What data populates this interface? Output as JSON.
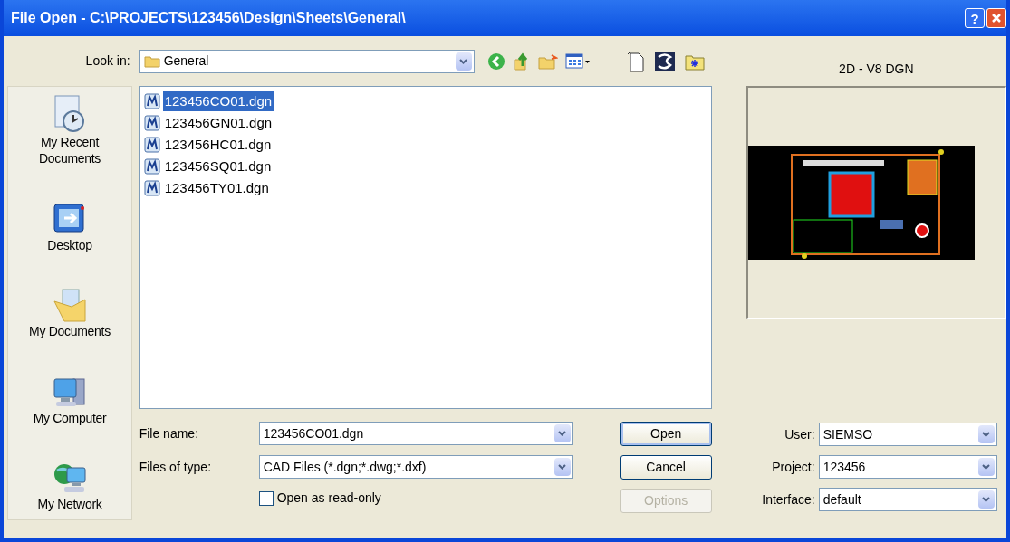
{
  "window": {
    "title": "File Open - C:\\PROJECTS\\123456\\Design\\Sheets\\General\\",
    "help_button": "?"
  },
  "look_in": {
    "label": "Look in:",
    "value": "General"
  },
  "places": [
    {
      "kind": "recent",
      "label": "My Recent Documents"
    },
    {
      "kind": "desktop",
      "label": "Desktop"
    },
    {
      "kind": "documents",
      "label": "My Documents"
    },
    {
      "kind": "computer",
      "label": "My Computer"
    },
    {
      "kind": "network",
      "label": "My Network"
    }
  ],
  "files": [
    {
      "name": "123456CO01.dgn",
      "selected": true
    },
    {
      "name": "123456GN01.dgn",
      "selected": false
    },
    {
      "name": "123456HC01.dgn",
      "selected": false
    },
    {
      "name": "123456SQ01.dgn",
      "selected": false
    },
    {
      "name": "123456TY01.dgn",
      "selected": false
    }
  ],
  "preview": {
    "label": "2D - V8 DGN"
  },
  "file_name": {
    "label": "File name:",
    "value": "123456CO01.dgn"
  },
  "file_type": {
    "label": "Files of type:",
    "value": "CAD Files (*.dgn;*.dwg;*.dxf)"
  },
  "read_only": {
    "label": "Open as read-only",
    "checked": false
  },
  "buttons": [
    {
      "label": "Open",
      "disabled": false,
      "default": true
    },
    {
      "label": "Cancel",
      "disabled": false,
      "default": false
    },
    {
      "label": "Options",
      "disabled": true,
      "default": false
    }
  ],
  "settings": [
    {
      "label": "User:",
      "value": "SIEMSO"
    },
    {
      "label": "Project:",
      "value": "123456"
    },
    {
      "label": "Interface:",
      "value": "default"
    }
  ]
}
